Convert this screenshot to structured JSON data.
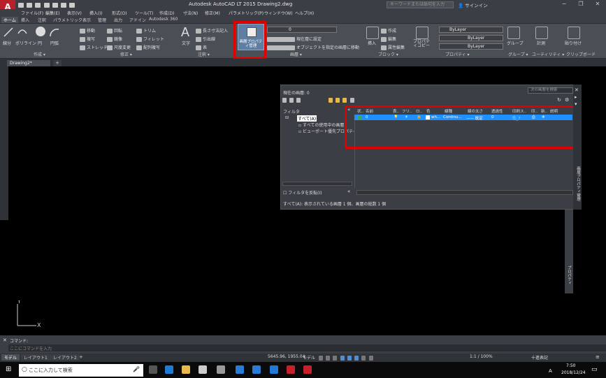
{
  "app": {
    "title": "Autodesk AutoCAD LT 2015 Drawing2.dwg",
    "logo": "A"
  },
  "search": {
    "placeholder": "キーワードまたは語句を入力"
  },
  "signin": "サインイン",
  "window_controls": {
    "minimize": "−",
    "restore": "❐",
    "close": "✕"
  },
  "menus": [
    "ファイル(F)",
    "編集(E)",
    "表示(V)",
    "挿入(I)",
    "形式(O)",
    "ツール(T)",
    "作成(D)",
    "寸法(N)",
    "修正(M)",
    "パラメトリック(P)",
    "ウィンドウ(W)",
    "ヘルプ(H)"
  ],
  "tabs": [
    "ホーム",
    "挿入",
    "注釈",
    "パラメトリック",
    "表示",
    "管理",
    "出力",
    "アドイン",
    "Autodesk 360"
  ],
  "ribbon": {
    "draw": {
      "panel": "作成 ▾",
      "line": "線分",
      "polyline": "ポリライン",
      "circle": "円",
      "arc": "円弧"
    },
    "modify": {
      "panel": "修正 ▾",
      "move": "移動",
      "rotate": "回転",
      "trim": "トリム",
      "copy": "複写",
      "mirror": "鏡像",
      "fillet": "フィレット",
      "stretch": "ストレッチ",
      "scale": "尺度変更",
      "array": "配列複写"
    },
    "annotation": {
      "panel": "注釈 ▾",
      "text": "文字",
      "linear": "長さ寸法記入",
      "leader": "引出線",
      "table": "表"
    },
    "layers": {
      "panel": "画層 ▾",
      "props_button": "画層プロパティ管理",
      "current_layer": "0",
      "set_current": "現在層に設定",
      "match": "オブジェクトを指定の画層に移動"
    },
    "block": {
      "panel": "ブロック ▾",
      "insert": "挿入",
      "create": "作成",
      "edit": "編集",
      "attr": "属性編集"
    },
    "properties": {
      "panel": "プロパティ ▾",
      "copy": "プロパティコピー",
      "color": "ByLayer",
      "linetype": "ByLayer",
      "lineweight": "ByLayer"
    },
    "groups": {
      "panel": "グループ ▾",
      "group": "グループ"
    },
    "utilities": {
      "panel": "ユーティリティ ▾",
      "measure": "計測"
    },
    "clipboard": {
      "panel": "クリップボード",
      "paste": "貼り付け"
    }
  },
  "document_tab": "Drawing2*",
  "layer_manager": {
    "current_layer": "現在の画層: 0",
    "search_placeholder": "次の画層を検索",
    "filter_label": "フィルタ",
    "tree": [
      "すべて(A)",
      "すべての使用中の画層",
      "ビューポート優先プロパティを含"
    ],
    "invert_filter": "フィルタを反転(I)",
    "columns": [
      "状..",
      "名前",
      "表..",
      "フリ..",
      "ロ..",
      "色",
      "線種",
      "線の太さ",
      "透過性",
      "印刷ス..",
      "印..",
      "新..",
      "説明"
    ],
    "row": {
      "name": "0",
      "color": "wh...",
      "linetype": "Continu...",
      "lineweight": "—— 既定",
      "transparency": "0",
      "plotstyle": "色_7"
    },
    "status": "すべて(A): 表示されている画層 1 個、画層の総数 1 個",
    "side_title": "画層プロパティ管理"
  },
  "right_strip_label": "プロパティ",
  "command": {
    "label": "コマンド:",
    "placeholder": "ここにコマンドを入力"
  },
  "layout_tabs": [
    "モデル",
    "レイアウト1",
    "レイアウト2"
  ],
  "status": {
    "coords": "5645.96, 1955.04",
    "mode": "モデル",
    "scale": "1:1 / 100%",
    "decimal": "十進表記"
  },
  "taskbar": {
    "search": "ここに入力して検索",
    "time": "7:50",
    "date": "2018/12/24",
    "lang": "A"
  }
}
